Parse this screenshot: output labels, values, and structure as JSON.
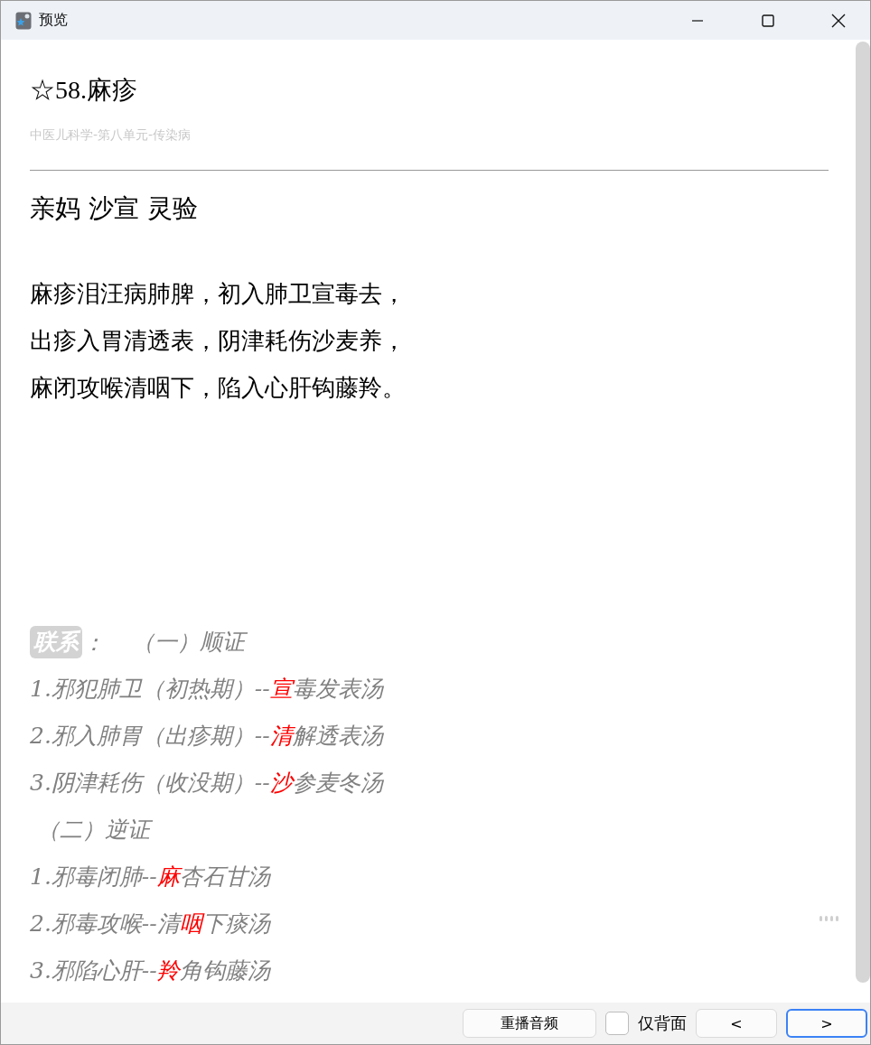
{
  "window": {
    "title": "预览"
  },
  "card": {
    "title": "☆58.麻疹",
    "subtitle": "中医儿科学-第八单元-传染病",
    "mnemonic": "亲妈 沙宣 灵验",
    "verse": [
      "麻疹泪汪病肺脾，初入肺卫宣毒去，",
      "出疹入胃清透表，阴津耗伤沙麦养，",
      "麻闭攻喉清咽下，陷入心肝钩藤羚。"
    ],
    "tag": "联系",
    "tag_suffix": "：",
    "notes": [
      {
        "kind": "heading",
        "segments": [
          {
            "text": "（一）顺证",
            "highlight": false
          }
        ]
      },
      {
        "kind": "item",
        "segments": [
          {
            "text": "1.邪犯肺卫（初热期）--",
            "highlight": false
          },
          {
            "text": "宣",
            "highlight": true
          },
          {
            "text": "毒发表汤",
            "highlight": false
          }
        ]
      },
      {
        "kind": "item",
        "segments": [
          {
            "text": "2.邪入肺胃（出疹期）--",
            "highlight": false
          },
          {
            "text": "清",
            "highlight": true
          },
          {
            "text": "解透表汤",
            "highlight": false
          }
        ]
      },
      {
        "kind": "item",
        "segments": [
          {
            "text": "3.阴津耗伤（收没期）--",
            "highlight": false
          },
          {
            "text": "沙",
            "highlight": true
          },
          {
            "text": "参麦冬汤",
            "highlight": false
          }
        ]
      },
      {
        "kind": "heading",
        "segments": [
          {
            "text": "（二）逆证",
            "highlight": false
          }
        ]
      },
      {
        "kind": "item",
        "segments": [
          {
            "text": "1.邪毒闭肺--",
            "highlight": false
          },
          {
            "text": "麻",
            "highlight": true
          },
          {
            "text": "杏石甘汤",
            "highlight": false
          }
        ]
      },
      {
        "kind": "item",
        "segments": [
          {
            "text": "2.邪毒攻喉--清",
            "highlight": false
          },
          {
            "text": "咽",
            "highlight": true
          },
          {
            "text": "下痰汤",
            "highlight": false
          }
        ]
      },
      {
        "kind": "item",
        "segments": [
          {
            "text": "3.邪陷心肝--",
            "highlight": false
          },
          {
            "text": "羚",
            "highlight": true
          },
          {
            "text": "角钩藤汤",
            "highlight": false
          }
        ]
      }
    ]
  },
  "footer": {
    "replay": {
      "label": "重播音频",
      "focused": false
    },
    "back_only": {
      "label": "仅背面",
      "checked": false
    },
    "prev": {
      "label": "<",
      "focused": false
    },
    "next": {
      "label": ">",
      "focused": true
    }
  }
}
